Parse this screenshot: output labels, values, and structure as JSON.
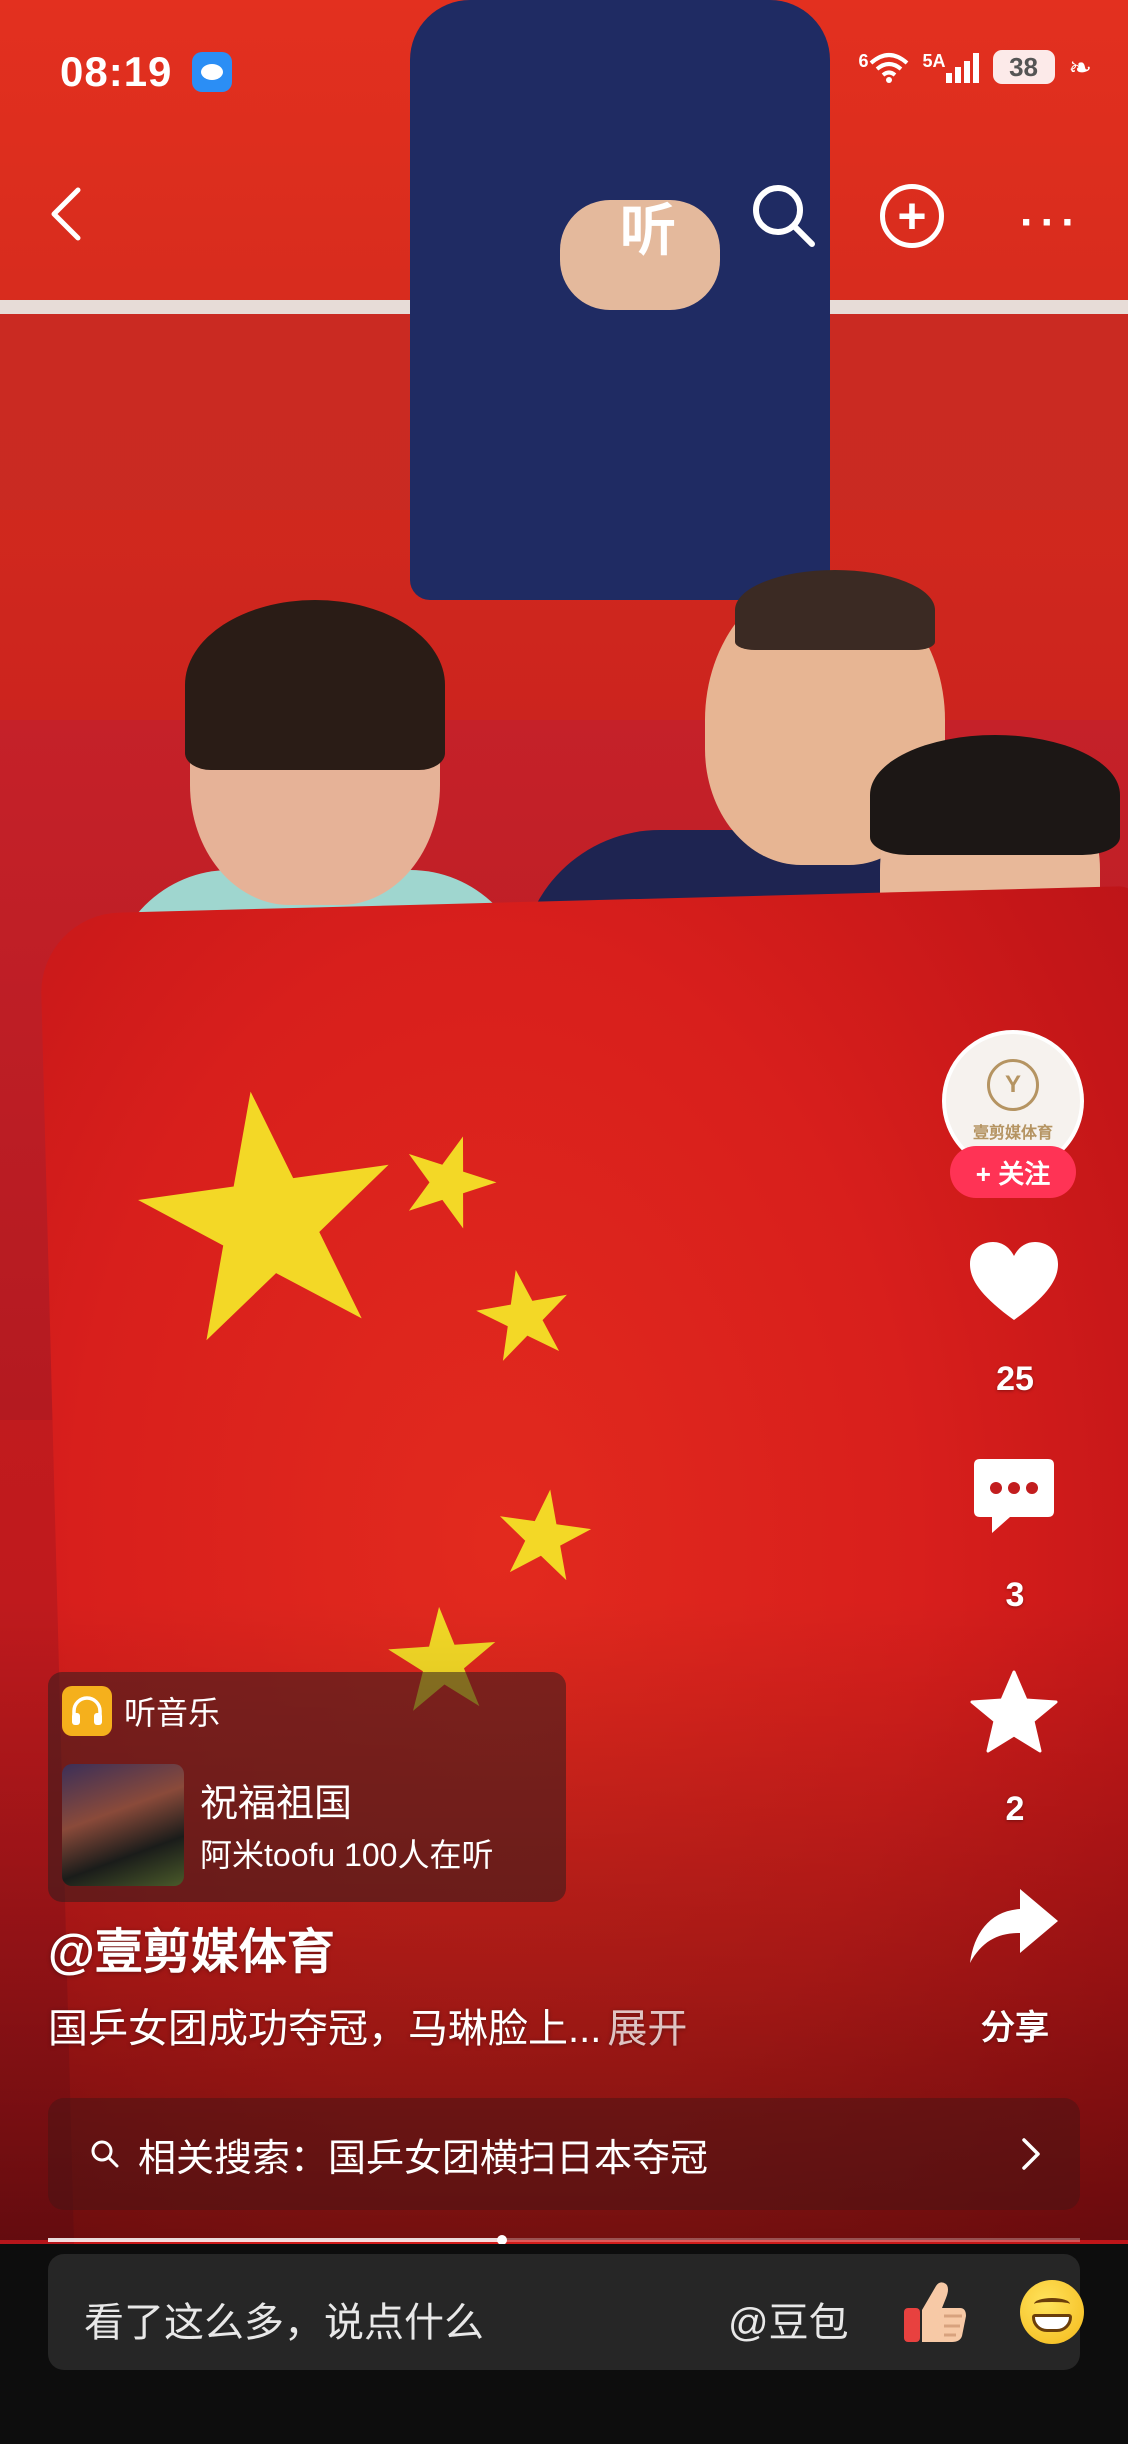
{
  "status_bar": {
    "time": "08:19",
    "network_wifi": "6",
    "network_cell": "5A",
    "battery": "38",
    "message_icon": "message-bubble-icon"
  },
  "top_nav": {
    "listen_label": "听",
    "back_icon": "chevron-left-icon",
    "search_icon": "search-icon",
    "add_icon": "plus-circle-icon",
    "more_icon": "more-icon"
  },
  "creator": {
    "avatar_text": "壹剪媒体育",
    "avatar_mark": "Y",
    "follow_label": "+ 关注"
  },
  "actions": {
    "likes": "25",
    "comments": "3",
    "favorites": "2",
    "share_label": "分享"
  },
  "music": {
    "tag": "听音乐",
    "title": "祝福祖国",
    "meta": "阿米toofu 100人在听"
  },
  "post": {
    "author": "@壹剪媒体育",
    "caption": "国乒女团成功夺冠，马琳脸上...",
    "expand_label": "展开"
  },
  "related_search": {
    "text": "相关搜索：国乒女团横扫日本夺冠"
  },
  "progress": {
    "played_fraction": 0.44
  },
  "comment_bar": {
    "placeholder": "看了这么多，说点什么",
    "mention": "@豆包"
  },
  "colors": {
    "accent_red": "#ff3355",
    "music_badge": "#f5b01c",
    "bottom_bar": "#0d0d0d"
  }
}
